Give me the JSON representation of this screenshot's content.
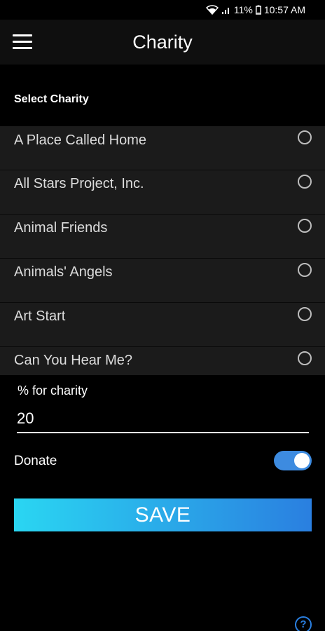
{
  "status_bar": {
    "battery": "11%",
    "time": "10:57 AM",
    "icons": [
      "wifi-icon",
      "signal-icon",
      "battery-icon"
    ]
  },
  "app_bar": {
    "title": "Charity",
    "menu_icon": "hamburger-menu-icon"
  },
  "select_label": "Select Charity",
  "charities": [
    {
      "name": "A Place Called Home",
      "selected": false
    },
    {
      "name": "All Stars Project, Inc.",
      "selected": false
    },
    {
      "name": "Animal Friends",
      "selected": false
    },
    {
      "name": "Animals' Angels",
      "selected": false
    },
    {
      "name": "Art Start",
      "selected": false
    },
    {
      "name": "Can You Hear Me?",
      "selected": false
    }
  ],
  "percent": {
    "label": "% for charity",
    "value": "20"
  },
  "donate": {
    "label": "Donate",
    "enabled": true
  },
  "save_label": "SAVE",
  "help_icon_glyph": "?",
  "colors": {
    "accent": "#3d8be0",
    "button_gradient_start": "#2ad6f2",
    "button_gradient_end": "#2a7fe0",
    "background": "#000000"
  }
}
